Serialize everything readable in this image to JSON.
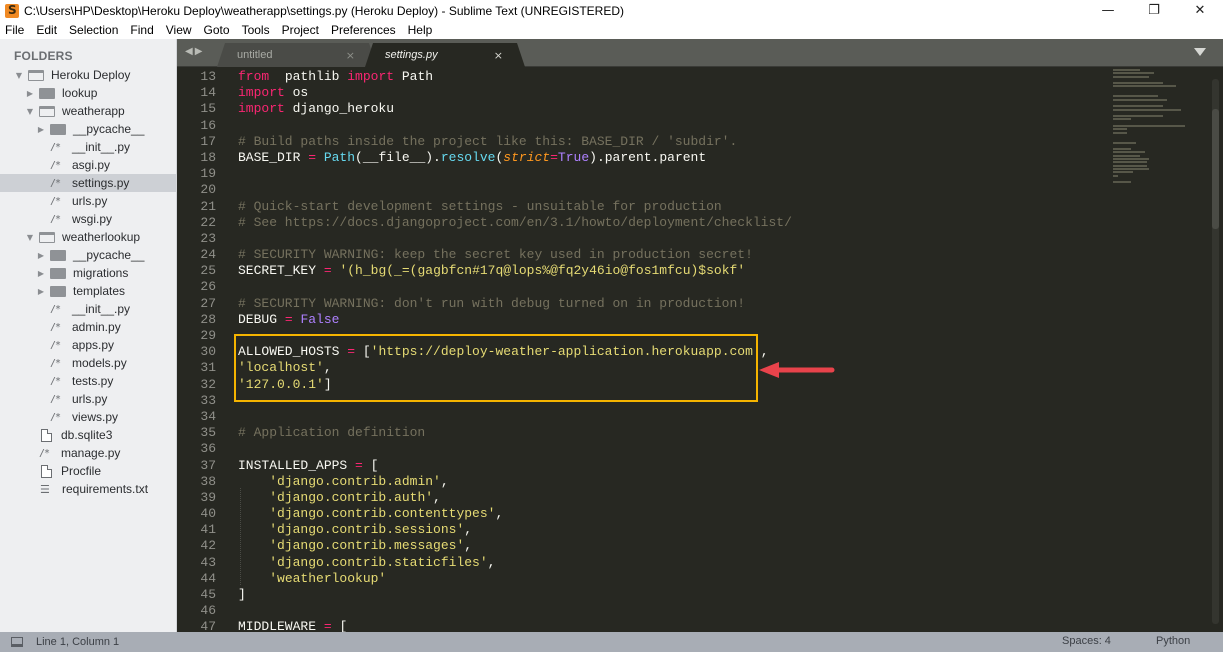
{
  "window": {
    "title": "C:\\Users\\HP\\Desktop\\Heroku Deploy\\weatherapp\\settings.py (Heroku Deploy) - Sublime Text (UNREGISTERED)",
    "controls": {
      "minimize": "—",
      "restore": "❐",
      "close": "✕"
    }
  },
  "menu": [
    "File",
    "Edit",
    "Selection",
    "Find",
    "View",
    "Goto",
    "Tools",
    "Project",
    "Preferences",
    "Help"
  ],
  "sidebar": {
    "header": "FOLDERS",
    "items": [
      {
        "label": "Heroku Deploy",
        "type": "folder-open",
        "depth": 0
      },
      {
        "label": "lookup",
        "type": "folder",
        "depth": 1
      },
      {
        "label": "weatherapp",
        "type": "folder-open",
        "depth": 1
      },
      {
        "label": "__pycache__",
        "type": "folder",
        "depth": 2
      },
      {
        "label": "__init__.py",
        "type": "file",
        "depth": 2
      },
      {
        "label": "asgi.py",
        "type": "file",
        "depth": 2
      },
      {
        "label": "settings.py",
        "type": "file",
        "depth": 2,
        "selected": true
      },
      {
        "label": "urls.py",
        "type": "file",
        "depth": 2
      },
      {
        "label": "wsgi.py",
        "type": "file",
        "depth": 2
      },
      {
        "label": "weatherlookup",
        "type": "folder-open",
        "depth": 1
      },
      {
        "label": "__pycache__",
        "type": "folder",
        "depth": 2
      },
      {
        "label": "migrations",
        "type": "folder",
        "depth": 2
      },
      {
        "label": "templates",
        "type": "folder",
        "depth": 2
      },
      {
        "label": "__init__.py",
        "type": "file",
        "depth": 2
      },
      {
        "label": "admin.py",
        "type": "file",
        "depth": 2
      },
      {
        "label": "apps.py",
        "type": "file",
        "depth": 2
      },
      {
        "label": "models.py",
        "type": "file",
        "depth": 2
      },
      {
        "label": "tests.py",
        "type": "file",
        "depth": 2
      },
      {
        "label": "urls.py",
        "type": "file",
        "depth": 2
      },
      {
        "label": "views.py",
        "type": "file",
        "depth": 2
      },
      {
        "label": "db.sqlite3",
        "type": "doc",
        "depth": 1
      },
      {
        "label": "manage.py",
        "type": "file",
        "depth": 1
      },
      {
        "label": "Procfile",
        "type": "doc",
        "depth": 1
      },
      {
        "label": "requirements.txt",
        "type": "text",
        "depth": 1
      }
    ]
  },
  "tabs": [
    {
      "label": "untitled",
      "active": false,
      "close": "×"
    },
    {
      "label": "settings.py",
      "active": true,
      "close": "×"
    }
  ],
  "tab_nav": "◀▶",
  "editor": {
    "line_numbers": [
      "13",
      "14",
      "15",
      "16",
      "17",
      "18",
      "19",
      "20",
      "21",
      "22",
      "23",
      "24",
      "25",
      "26",
      "27",
      "28",
      "29",
      "30",
      "31",
      "32",
      "33",
      "34",
      "35",
      "36",
      "37",
      "38",
      "39",
      "40",
      "41",
      "42",
      "43",
      "44",
      "45",
      "46",
      "47"
    ],
    "lines": [
      [
        [
          "kw",
          "from"
        ],
        [
          "",
          "  pathlib "
        ],
        [
          "kw",
          "import"
        ],
        [
          "",
          " Path"
        ]
      ],
      [
        [
          "kw",
          "import"
        ],
        [
          "",
          " os"
        ]
      ],
      [
        [
          "kw",
          "import"
        ],
        [
          "",
          " django_heroku"
        ]
      ],
      [],
      [
        [
          "cm",
          "# Build paths inside the project like this: BASE_DIR / 'subdir'."
        ]
      ],
      [
        [
          "",
          "BASE_DIR "
        ],
        [
          "op",
          "="
        ],
        [
          " ",
          ""
        ],
        [
          "fn",
          " Path"
        ],
        [
          "",
          "(__file__)."
        ],
        [
          "fn",
          "resolve"
        ],
        [
          "",
          "("
        ],
        [
          "pa",
          "strict"
        ],
        [
          "op",
          "="
        ],
        [
          "cn",
          "True"
        ],
        [
          "",
          ").parent.parent"
        ]
      ],
      [],
      [],
      [
        [
          "cm",
          "# Quick-start development settings - unsuitable for production"
        ]
      ],
      [
        [
          "cm",
          "# See https://docs.djangoproject.com/en/3.1/howto/deployment/checklist/"
        ]
      ],
      [],
      [
        [
          "cm",
          "# SECURITY WARNING: keep the secret key used in production secret!"
        ]
      ],
      [
        [
          "",
          "SECRET_KEY "
        ],
        [
          "op",
          "="
        ],
        [
          "",
          " "
        ],
        [
          "st",
          "'(h_bg(_=(gagbfcn#17q@lops%@fq2y46io@fos1mfcu)$sokf'"
        ]
      ],
      [],
      [
        [
          "cm",
          "# SECURITY WARNING: don't run with debug turned on in production!"
        ]
      ],
      [
        [
          "",
          "DEBUG "
        ],
        [
          "op",
          "="
        ],
        [
          "",
          " "
        ],
        [
          "cn",
          "False"
        ]
      ],
      [],
      [
        [
          "",
          "ALLOWED_HOSTS "
        ],
        [
          "op",
          "="
        ],
        [
          "",
          " ["
        ],
        [
          "st",
          "'https://deploy-weather-application.herokuapp.com'"
        ],
        [
          "",
          ","
        ]
      ],
      [
        [
          "st",
          "'localhost'"
        ],
        [
          "",
          ","
        ]
      ],
      [
        [
          "st",
          "'127.0.0.1'"
        ],
        [
          "",
          "]"
        ]
      ],
      [],
      [],
      [
        [
          "cm",
          "# Application definition"
        ]
      ],
      [],
      [
        [
          "",
          "INSTALLED_APPS "
        ],
        [
          "op",
          "="
        ],
        [
          "",
          " ["
        ]
      ],
      [
        [
          "",
          "    "
        ],
        [
          "st",
          "'django.contrib.admin'"
        ],
        [
          "",
          ","
        ]
      ],
      [
        [
          "",
          "    "
        ],
        [
          "st",
          "'django.contrib.auth'"
        ],
        [
          "",
          ","
        ]
      ],
      [
        [
          "",
          "    "
        ],
        [
          "st",
          "'django.contrib.contenttypes'"
        ],
        [
          "",
          ","
        ]
      ],
      [
        [
          "",
          "    "
        ],
        [
          "st",
          "'django.contrib.sessions'"
        ],
        [
          "",
          ","
        ]
      ],
      [
        [
          "",
          "    "
        ],
        [
          "st",
          "'django.contrib.messages'"
        ],
        [
          "",
          ","
        ]
      ],
      [
        [
          "",
          "    "
        ],
        [
          "st",
          "'django.contrib.staticfiles'"
        ],
        [
          "",
          ","
        ]
      ],
      [
        [
          "",
          "    "
        ],
        [
          "st",
          "'weatherlookup'"
        ]
      ],
      [
        [
          "",
          "]"
        ]
      ],
      [],
      [
        [
          "",
          "MIDDLEWARE "
        ],
        [
          "op",
          "="
        ],
        [
          "",
          " ["
        ]
      ]
    ]
  },
  "annotation": {
    "box_color": "#f5b400",
    "arrow_color": "#e8434b"
  },
  "statusbar": {
    "position": "Line 1, Column 1",
    "indentation": "Spaces: 4",
    "syntax": "Python"
  }
}
